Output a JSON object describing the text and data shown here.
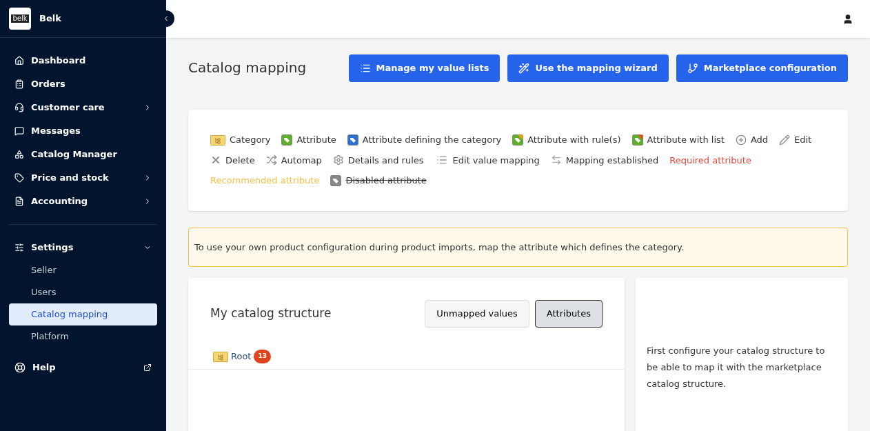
{
  "brand": {
    "logo": "belk",
    "name": "Belk"
  },
  "sidebar": {
    "items": [
      {
        "label": "Dashboard",
        "has_submenu": false
      },
      {
        "label": "Orders",
        "has_submenu": false
      },
      {
        "label": "Customer care",
        "has_submenu": true
      },
      {
        "label": "Messages",
        "has_submenu": false
      },
      {
        "label": "Catalog Manager",
        "has_submenu": false
      },
      {
        "label": "Price and stock",
        "has_submenu": true
      },
      {
        "label": "Accounting",
        "has_submenu": true
      }
    ],
    "settings": {
      "label": "Settings",
      "expanded": true,
      "children": [
        {
          "label": "Seller",
          "selected": false
        },
        {
          "label": "Users",
          "selected": false
        },
        {
          "label": "Catalog mapping",
          "selected": true
        },
        {
          "label": "Platform",
          "selected": false
        }
      ]
    },
    "help": {
      "label": "Help"
    }
  },
  "page": {
    "title": "Catalog mapping",
    "actions": [
      {
        "label": "Manage my value lists"
      },
      {
        "label": "Use the mapping wizard"
      },
      {
        "label": "Marketplace configuration"
      }
    ]
  },
  "legend": [
    {
      "kind": "category",
      "label": "Category"
    },
    {
      "kind": "attribute",
      "label": "Attribute"
    },
    {
      "kind": "defining",
      "label": "Attribute defining the category"
    },
    {
      "kind": "rule",
      "label": "Attribute with rule(s)"
    },
    {
      "kind": "list",
      "label": "Attribute with list"
    },
    {
      "kind": "add",
      "label": "Add"
    },
    {
      "kind": "edit",
      "label": "Edit"
    },
    {
      "kind": "delete",
      "label": "Delete"
    },
    {
      "kind": "automap",
      "label": "Automap"
    },
    {
      "kind": "details",
      "label": "Details and rules"
    },
    {
      "kind": "value-mapping",
      "label": "Edit value mapping"
    },
    {
      "kind": "mapping",
      "label": "Mapping established"
    },
    {
      "kind": "required",
      "label": "Required attribute"
    },
    {
      "kind": "recommended",
      "label": "Recommended attribute"
    },
    {
      "kind": "disabled",
      "label": "Disabled attribute"
    }
  ],
  "notice": "To use your own product configuration during product imports, map the attribute which defines the category.",
  "structure": {
    "title": "My catalog structure",
    "tabs": [
      {
        "label": "Unmapped values",
        "selected": false
      },
      {
        "label": "Attributes",
        "selected": true
      }
    ],
    "tree": [
      {
        "label": "Root",
        "count": "13"
      }
    ]
  },
  "side_note": "First configure your catalog structure to be able to map it with the marketplace catalog structure."
}
